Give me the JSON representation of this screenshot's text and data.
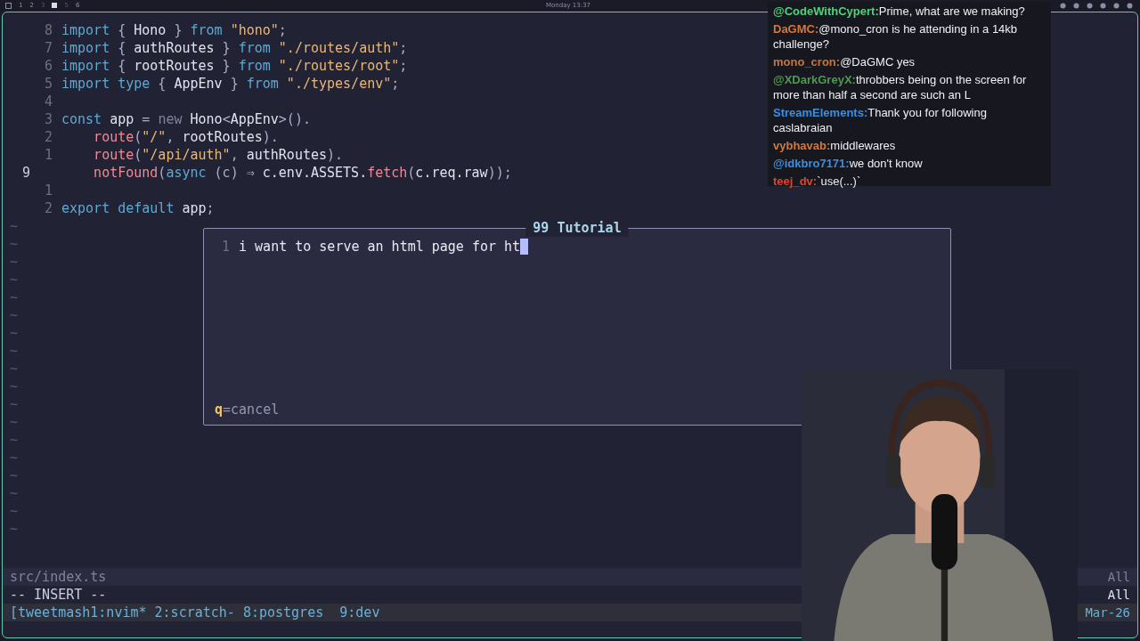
{
  "top_bar": {
    "workspaces": [
      {
        "label": "1",
        "selected": false
      },
      {
        "label": "2",
        "selected": false
      },
      {
        "label": "3",
        "selected": false
      },
      {
        "selected": true
      },
      {
        "label": "5",
        "selected": false
      },
      {
        "label": "6",
        "selected": false
      }
    ],
    "clock": "Monday 13:37"
  },
  "editor": {
    "lines": [
      {
        "number": "8",
        "current": false,
        "tokens": [
          {
            "kind": "keyword",
            "text": "import"
          },
          {
            "kind": "punct",
            "text": " { "
          },
          {
            "kind": "plain",
            "text": "Hono"
          },
          {
            "kind": "punct",
            "text": " } "
          },
          {
            "kind": "keyword",
            "text": "from"
          },
          {
            "kind": "string",
            "text": " \"hono\""
          },
          {
            "kind": "punct",
            "text": ";"
          }
        ]
      },
      {
        "number": "7",
        "current": false,
        "tokens": [
          {
            "kind": "keyword",
            "text": "import"
          },
          {
            "kind": "punct",
            "text": " { "
          },
          {
            "kind": "plain",
            "text": "authRoutes"
          },
          {
            "kind": "punct",
            "text": " } "
          },
          {
            "kind": "keyword",
            "text": "from"
          },
          {
            "kind": "string",
            "text": " \"./routes/auth\""
          },
          {
            "kind": "punct",
            "text": ";"
          }
        ]
      },
      {
        "number": "6",
        "current": false,
        "tokens": [
          {
            "kind": "keyword",
            "text": "import"
          },
          {
            "kind": "punct",
            "text": " { "
          },
          {
            "kind": "plain",
            "text": "rootRoutes"
          },
          {
            "kind": "punct",
            "text": " } "
          },
          {
            "kind": "keyword",
            "text": "from"
          },
          {
            "kind": "string",
            "text": " \"./routes/root\""
          },
          {
            "kind": "punct",
            "text": ";"
          }
        ]
      },
      {
        "number": "5",
        "current": false,
        "tokens": [
          {
            "kind": "keyword",
            "text": "import type"
          },
          {
            "kind": "punct",
            "text": " { "
          },
          {
            "kind": "plain",
            "text": "AppEnv"
          },
          {
            "kind": "punct",
            "text": " } "
          },
          {
            "kind": "keyword",
            "text": "from"
          },
          {
            "kind": "string",
            "text": " \"./types/env\""
          },
          {
            "kind": "punct",
            "text": ";"
          }
        ]
      },
      {
        "number": "4",
        "current": false
      },
      {
        "number": "3",
        "current": false,
        "tokens": [
          {
            "kind": "keyword",
            "text": "const"
          },
          {
            "kind": "plain",
            "text": " app "
          },
          {
            "kind": "punct",
            "text": "= "
          },
          {
            "kind": "muted",
            "text": "new"
          },
          {
            "kind": "plain",
            "text": " Hono"
          },
          {
            "kind": "punct",
            "text": "<"
          },
          {
            "kind": "plain",
            "text": "AppEnv"
          },
          {
            "kind": "punct",
            "text": ">()."
          }
        ]
      },
      {
        "number": "2",
        "current": false,
        "indented": true,
        "tokens": [
          {
            "kind": "method",
            "text": "route"
          },
          {
            "kind": "punct",
            "text": "("
          },
          {
            "kind": "string",
            "text": "\"/\""
          },
          {
            "kind": "punct",
            "text": ", "
          },
          {
            "kind": "plain",
            "text": "rootRoutes"
          },
          {
            "kind": "punct",
            "text": ")."
          }
        ]
      },
      {
        "number": "1",
        "current": false,
        "indented": true,
        "tokens": [
          {
            "kind": "method",
            "text": "route"
          },
          {
            "kind": "punct",
            "text": "("
          },
          {
            "kind": "string",
            "text": "\"/api/auth\""
          },
          {
            "kind": "punct",
            "text": ", "
          },
          {
            "kind": "plain",
            "text": "authRoutes"
          },
          {
            "kind": "punct",
            "text": ")."
          }
        ]
      },
      {
        "number": "9",
        "current": true,
        "indented": true,
        "tokens": [
          {
            "kind": "method",
            "text": "notFound"
          },
          {
            "kind": "punct",
            "text": "("
          },
          {
            "kind": "keyword",
            "text": "async"
          },
          {
            "kind": "punct",
            "text": " (c) ⇒ "
          },
          {
            "kind": "plain",
            "text": "c.env.ASSETS."
          },
          {
            "kind": "method",
            "text": "fetch"
          },
          {
            "kind": "punct",
            "text": "("
          },
          {
            "kind": "plain",
            "text": "c.req.raw"
          },
          {
            "kind": "punct",
            "text": "));"
          }
        ]
      },
      {
        "number": "1",
        "current": false
      },
      {
        "number": "2",
        "current": false,
        "tokens": [
          {
            "kind": "keyword",
            "text": "export default"
          },
          {
            "kind": "plain",
            "text": " app"
          },
          {
            "kind": "punct",
            "text": ";"
          }
        ]
      }
    ],
    "empty_line_markers": [
      "~",
      "~",
      "~",
      "~",
      "~",
      "~",
      "~",
      "~",
      "~",
      "~",
      "~",
      "~",
      "~",
      "~",
      "~",
      "~",
      "~",
      "~"
    ]
  },
  "popup": {
    "title": "99 Tutorial",
    "line_number": "1",
    "value": "i want to serve an html page for ht",
    "hint_key": "q",
    "hint_text": "=cancel"
  },
  "status_line": {
    "file": "src/index.ts",
    "position": "All"
  },
  "mode_line": {
    "mode": "-- INSERT --",
    "position": "All"
  },
  "tmux_bar": {
    "windows": "[tweetmash1:nvim* 2:scratch- 8:postgres  9:dev",
    "date": "Mar-26"
  },
  "chat": [
    {
      "user": "@CodeWithCypert:",
      "color": "#4fd27a",
      "text": "Prime, what are we making?"
    },
    {
      "user": "DaGMC:",
      "color": "#d2783c",
      "text": "@mono_cron is he attending in a 14kb challenge?"
    },
    {
      "user": "mono_cron:",
      "color": "#c8743a",
      "text": "@DaGMC yes"
    },
    {
      "user": "@XDarkGreyX:",
      "color": "#4e9a50",
      "text": "throbbers being on the screen for more than half a second are such an L"
    },
    {
      "user": "StreamElements:",
      "color": "#3c8ee0",
      "text": "Thank you for following caslabraian"
    },
    {
      "user": "vybhavab:",
      "color": "#d2783c",
      "text": "middlewares"
    },
    {
      "user": "@idkbro7171:",
      "color": "#3c8ee0",
      "text": "we don't know"
    },
    {
      "user": "teej_dv:",
      "color": "#e0442c",
      "text": "`use(...)`"
    }
  ]
}
